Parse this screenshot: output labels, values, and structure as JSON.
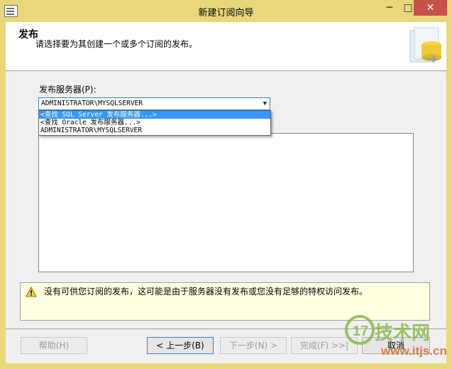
{
  "window": {
    "title": "新建订阅向导",
    "minimize": "─",
    "maximize": "□",
    "close": "✕"
  },
  "header": {
    "title": "发布",
    "description": "请选择要为其创建一个或多个订阅的发布。"
  },
  "publisher": {
    "label": "发布服务器(P):",
    "selected": "ADMINISTRATOR\\MYSQLSERVER",
    "options": [
      "<查找 SQL Server 发布服务器...>",
      "<查找 Oracle 发布服务器...>",
      "ADMINISTRATOR\\MYSQLSERVER"
    ],
    "highlighted_index": 0
  },
  "message": {
    "text": "没有可供您订阅的发布，这可能是由于服务器没有发布或您没有足够的特权访问发布。",
    "icon": "warning-icon"
  },
  "buttons": {
    "help": "帮助(H)",
    "back": "< 上一步(B)",
    "next": "下一步(N) >",
    "finish": "完成(F) >>|",
    "cancel": "取消"
  },
  "watermark": {
    "text": "技术网",
    "url": "www.itjs.cn"
  },
  "colors": {
    "title_bar": "#e9d77c",
    "close_button": "#c7504b",
    "selection": "#3399ff",
    "warning_bg": "#ffffe1"
  }
}
